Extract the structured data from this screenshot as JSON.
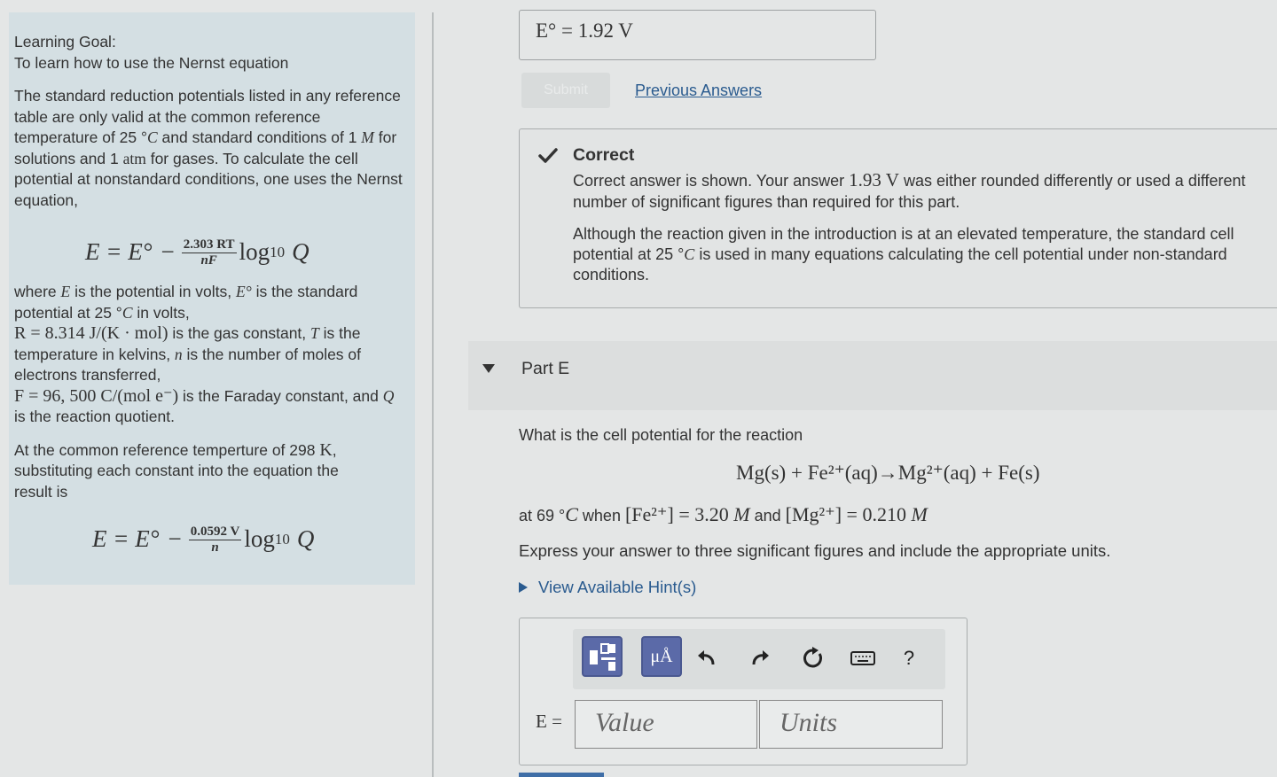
{
  "goal": {
    "heading": "Learning Goal:",
    "subheading": "To learn how to use the Nernst equation",
    "intro_a": "The standard reduction potentials listed in any reference table are only valid at the common reference temperature of 25 °",
    "intro_b": " and standard conditions of 1 ",
    "intro_c": " for solutions and 1 ",
    "intro_d": " for gases. To calculate the cell potential at nonstandard conditions, one uses the Nernst equation,",
    "formula1": {
      "lhs": "E = E°",
      "minus": "−",
      "num": "2.303 RT",
      "den": "nF",
      "log": "log",
      "log_sub": "10",
      "q": "Q"
    },
    "where_text": [
      "where ",
      "E",
      " is the potential in volts, ",
      "E°",
      " is the standard potential at 25 °",
      "C",
      " in volts,",
      "R = 8.314 J/(K · mol)",
      " is the gas constant, ",
      "T",
      " is the temperature in kelvins, ",
      "n",
      " is the number of moles of electrons transferred,",
      "F = 96, 500 C/(mol e⁻)",
      " is the Faraday constant, and ",
      "Q",
      " is the reaction quotient."
    ],
    "temp_text_a": "At the common reference temperture of 298 ",
    "temp_text_k": "K",
    "temp_text_b": ", substituting each constant into the equation the result is",
    "formula2": {
      "lhs": "E = E°",
      "minus": "−",
      "num": "0.0592 V",
      "den": "n",
      "log": "log",
      "log_sub": "10",
      "q": "Q"
    },
    "unit_C": "C",
    "unit_M": "M",
    "unit_atm": "atm"
  },
  "prev_answer": {
    "value": "E° = 1.92 V"
  },
  "submit_label": "Submit",
  "previous_answers_label": "Previous Answers",
  "feedback": {
    "title": "Correct",
    "text1_a": "Correct answer is shown. Your answer ",
    "text1_val": "1.93 V",
    "text1_b": " was either rounded differently or used a different number of significant figures than required for this part.",
    "text2_a": "Although the reaction given in the introduction is at an elevated temperature, the standard cell potential at 25 °",
    "text2_c": "C",
    "text2_b": " is used in many equations calculating the cell potential under non-standard conditions."
  },
  "part": {
    "label": "Part E"
  },
  "question": "What is the cell potential for the reaction",
  "reaction": "Mg(s) + Fe²⁺(aq)→Mg²⁺(aq) + Fe(s)",
  "conditions": {
    "a": "at 69 °",
    "c": "C",
    "b": " when ",
    "fe": "[Fe²⁺] = 3.20 ",
    "m1": "M",
    "and": " and ",
    "mg": "[Mg²⁺] = 0.210 ",
    "m2": "M"
  },
  "instructions": "Express your answer to three significant figures and include the appropriate units.",
  "hints_label": "View Available Hint(s)",
  "answer": {
    "label": "E =",
    "value_placeholder": "Value",
    "units_placeholder": "Units",
    "help_label": "?",
    "units_button_label": "μÅ"
  }
}
